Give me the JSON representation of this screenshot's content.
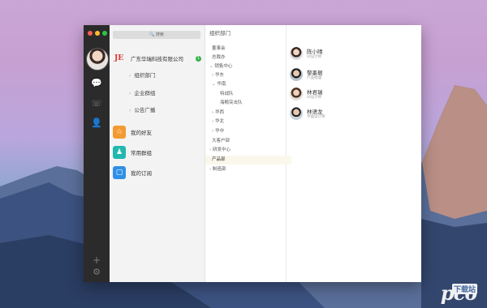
{
  "window": {
    "search": {
      "label": "搜索"
    },
    "org": {
      "logo": "JE",
      "company_name": "广东华瑞科技有限公司",
      "badge": "1"
    },
    "subitems": [
      {
        "label": "组织部门"
      },
      {
        "label": "企业群组"
      },
      {
        "label": "公告广播"
      }
    ],
    "entries": [
      {
        "label": "我的好友",
        "color": "#f39a32",
        "icon": "star-icon",
        "glyph": "☆"
      },
      {
        "label": "常用群组",
        "color": "#22b8b0",
        "icon": "group-icon",
        "glyph": "♟"
      },
      {
        "label": "我的订阅",
        "color": "#2f8fe6",
        "icon": "subscription-icon",
        "glyph": "▢"
      }
    ],
    "dept_header": "组织部门",
    "tree": [
      {
        "label": "董事会",
        "prefix": ""
      },
      {
        "label": "总裁办",
        "prefix": ""
      },
      {
        "label": "销售中心",
        "prefix": "⌄ "
      },
      {
        "label": "华东",
        "prefix": "› "
      },
      {
        "label": "华南",
        "prefix": "⌄ "
      },
      {
        "label": "特战队",
        "prefix": ""
      },
      {
        "label": "海鲸突击队",
        "prefix": ""
      },
      {
        "label": "华西",
        "prefix": "› "
      },
      {
        "label": "华北",
        "prefix": "› "
      },
      {
        "label": "华中",
        "prefix": "› "
      },
      {
        "label": "大客户部",
        "prefix": ""
      },
      {
        "label": "研发中心",
        "prefix": "› "
      },
      {
        "label": "产品部",
        "prefix": ""
      },
      {
        "label": "制造部",
        "prefix": "› "
      }
    ],
    "people": [
      {
        "name": "陈小晴",
        "role": "UI设计师"
      },
      {
        "name": "黎墨琚",
        "role": "产品经理"
      },
      {
        "name": "林君瑞",
        "role": "UI设计师"
      },
      {
        "name": "林语龙",
        "role": "平面设计师"
      }
    ]
  },
  "watermark": {
    "main": "pc6",
    "tag": "下载站"
  }
}
